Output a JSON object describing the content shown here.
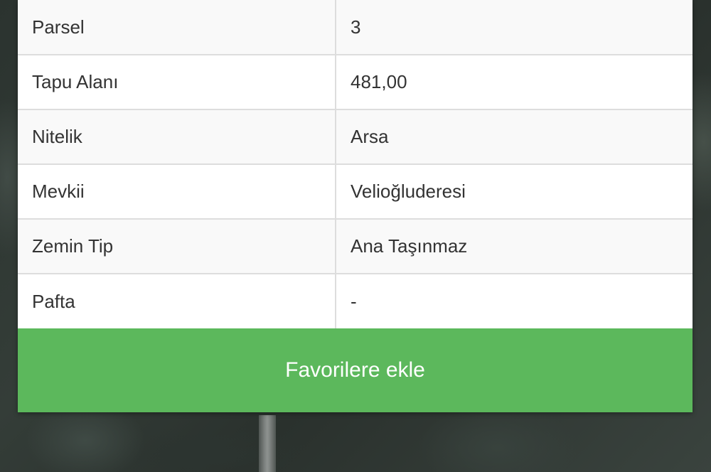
{
  "details": {
    "rows": [
      {
        "label": "Parsel",
        "value": "3"
      },
      {
        "label": "Tapu Alanı",
        "value": "481,00"
      },
      {
        "label": "Nitelik",
        "value": "Arsa"
      },
      {
        "label": "Mevkii",
        "value": "Velioğluderesi"
      },
      {
        "label": "Zemin Tip",
        "value": "Ana Taşınmaz"
      },
      {
        "label": "Pafta",
        "value": "-"
      }
    ]
  },
  "actions": {
    "favorite_label": "Favorilere ekle"
  },
  "colors": {
    "button_green": "#5cb85c",
    "row_alt": "#f9f9f9",
    "border": "#dddddd"
  }
}
